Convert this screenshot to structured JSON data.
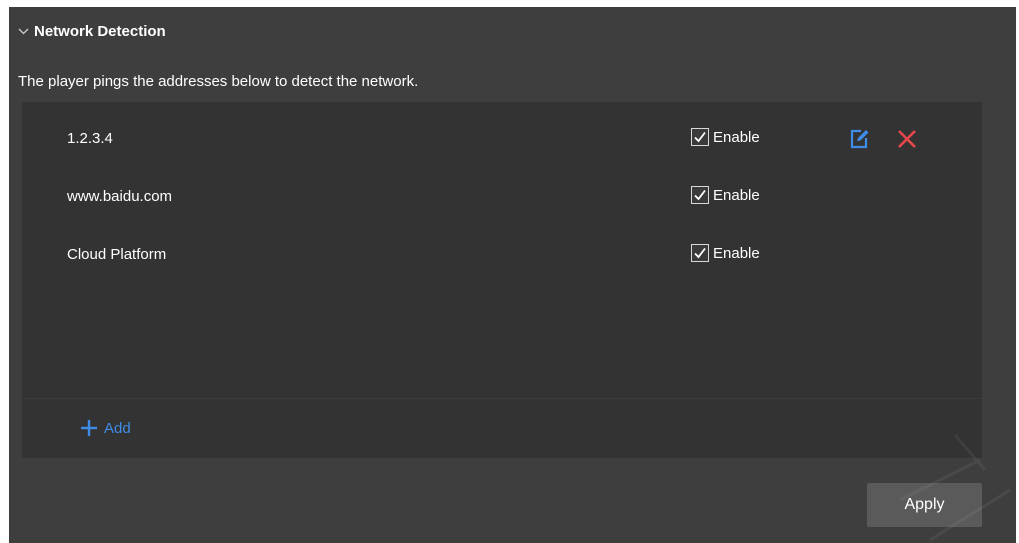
{
  "section": {
    "title": "Network Detection",
    "icon": "chevron-down-icon",
    "expanded": true
  },
  "description": "The player pings the addresses below to detect the network.",
  "addresses": [
    {
      "address": "1.2.3.4",
      "enabled": true,
      "enable_label": "Enable",
      "show_actions": true
    },
    {
      "address": "www.baidu.com",
      "enabled": true,
      "enable_label": "Enable",
      "show_actions": false
    },
    {
      "address": "Cloud Platform",
      "enabled": true,
      "enable_label": "Enable",
      "show_actions": false
    }
  ],
  "actions": {
    "edit_icon": "edit-icon",
    "delete_icon": "close-icon"
  },
  "add": {
    "label": "Add",
    "icon": "plus-icon"
  },
  "apply": {
    "label": "Apply"
  },
  "colors": {
    "panel_bg": "#3e3e3e",
    "list_bg": "#333333",
    "accent_blue": "#3f8ce8",
    "delete_red": "#e8474b",
    "apply_bg": "#5a5a5a"
  }
}
